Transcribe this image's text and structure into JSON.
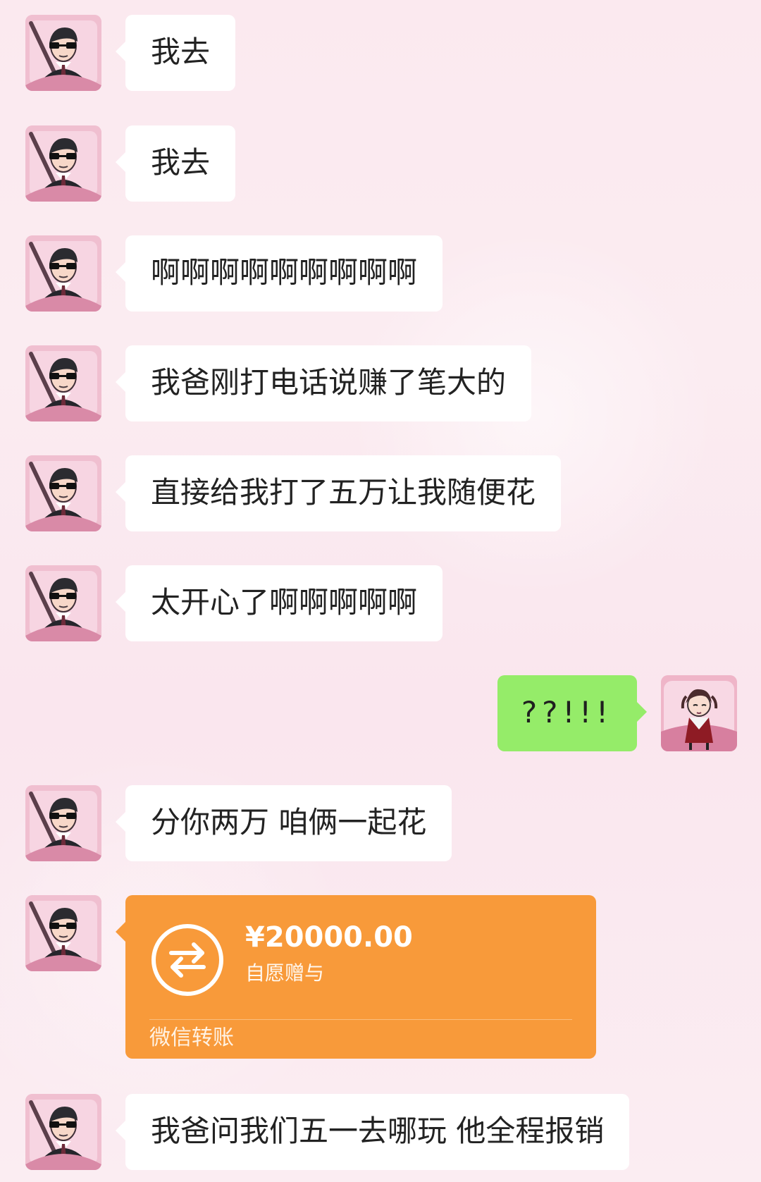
{
  "messages": [
    {
      "side": "left",
      "text": "我去"
    },
    {
      "side": "left",
      "text": "我去"
    },
    {
      "side": "left",
      "text": "啊啊啊啊啊啊啊啊啊"
    },
    {
      "side": "left",
      "text": "我爸刚打电话说赚了笔大的"
    },
    {
      "side": "left",
      "text": "直接给我打了五万让我随便花"
    },
    {
      "side": "left",
      "text": "太开心了啊啊啊啊啊"
    },
    {
      "side": "right",
      "text": "??!!!"
    },
    {
      "side": "left",
      "text": "分你两万 咱俩一起花"
    },
    {
      "side": "left",
      "type": "transfer",
      "amount": "¥20000.00",
      "note": "自愿赠与",
      "label": "微信转账"
    },
    {
      "side": "left",
      "text": "我爸问我们五一去哪玩 他全程报销"
    }
  ],
  "colors": {
    "bubble_left": "#ffffff",
    "bubble_right": "#95ec69",
    "transfer": "#f89a3a",
    "background": "#fbe9ef"
  },
  "icons": {
    "left_avatar": "driver-avatar-icon",
    "right_avatar": "girl-avatar-icon",
    "transfer": "transfer-arrows-icon"
  }
}
